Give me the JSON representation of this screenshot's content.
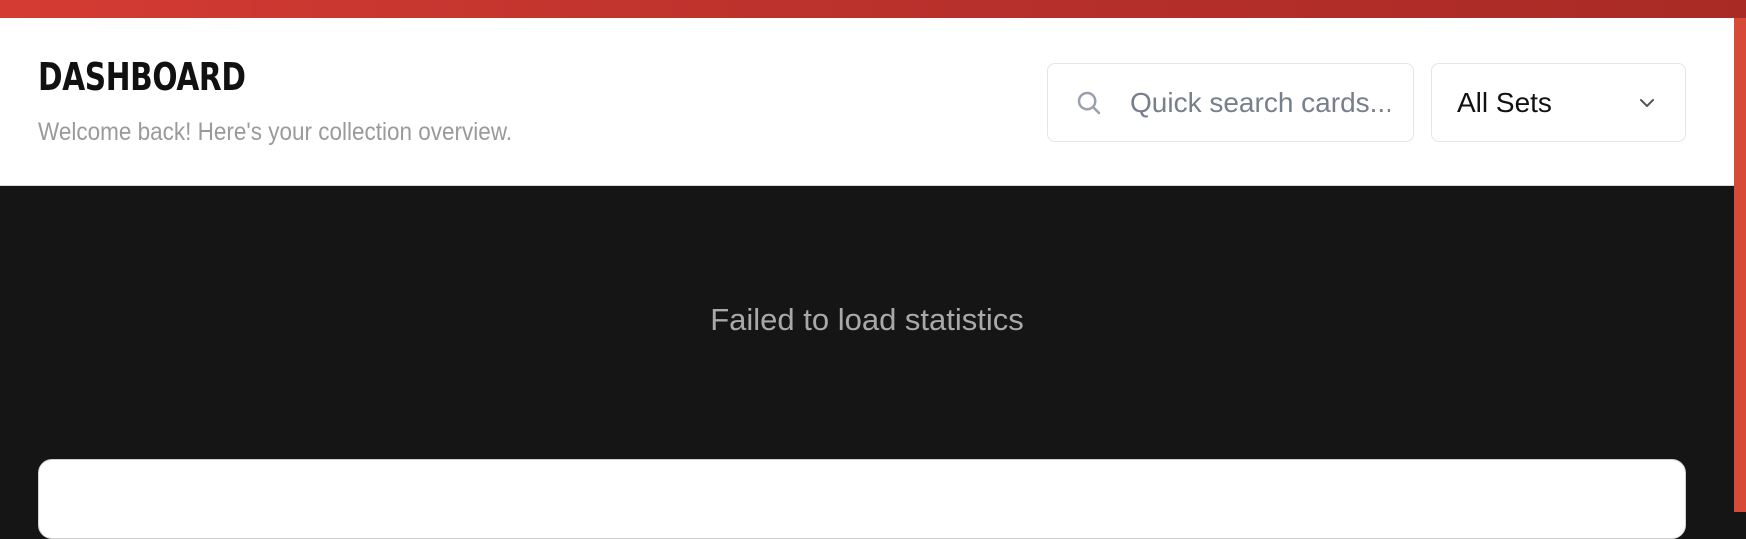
{
  "header": {
    "title": "DASHBOARD",
    "subtitle": "Welcome back! Here's your collection overview."
  },
  "search": {
    "placeholder": "Quick search cards...",
    "icon": "search-icon"
  },
  "set_filter": {
    "selected": "All Sets",
    "icon": "chevron-down-icon"
  },
  "statistics": {
    "error_message": "Failed to load statistics"
  },
  "colors": {
    "accent": "#c8342c",
    "header_background": "#ffffff",
    "content_background": "#151515",
    "muted_text": "#a9a9a9"
  }
}
